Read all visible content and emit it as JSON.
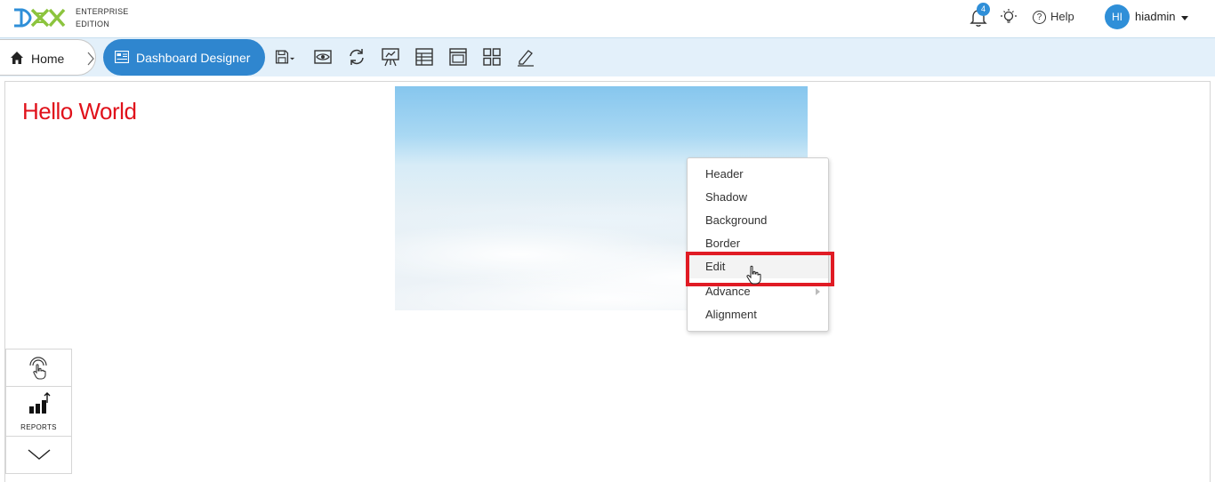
{
  "header": {
    "logo": "helical-insight-logo",
    "edition_line1": "ENTERPRISE",
    "edition_line2": "EDITION",
    "notification_count": "4",
    "help_label": "Help",
    "avatar_initials": "HI",
    "username": "hiadmin"
  },
  "breadcrumb": {
    "home_label": "Home",
    "current_label": "Dashboard Designer"
  },
  "toolbar": {
    "icons": [
      "save-icon",
      "preview-icon",
      "refresh-icon",
      "presentation-icon",
      "table-icon",
      "window-icon",
      "grid-icon",
      "edit-pencil-icon"
    ]
  },
  "canvas": {
    "heading": "Hello World",
    "heading_color": "#e0121b"
  },
  "context_menu": {
    "items": [
      "Header",
      "Shadow",
      "Background",
      "Border",
      "Edit",
      "Advance",
      "Alignment"
    ],
    "hovered": "Edit",
    "has_submenu": "Advance"
  },
  "side_panel": {
    "reports_label": "REPORTS"
  },
  "colors": {
    "accent": "#2f86cf",
    "toolbar_bg": "#e3f0fa",
    "highlight": "#e01b24"
  }
}
